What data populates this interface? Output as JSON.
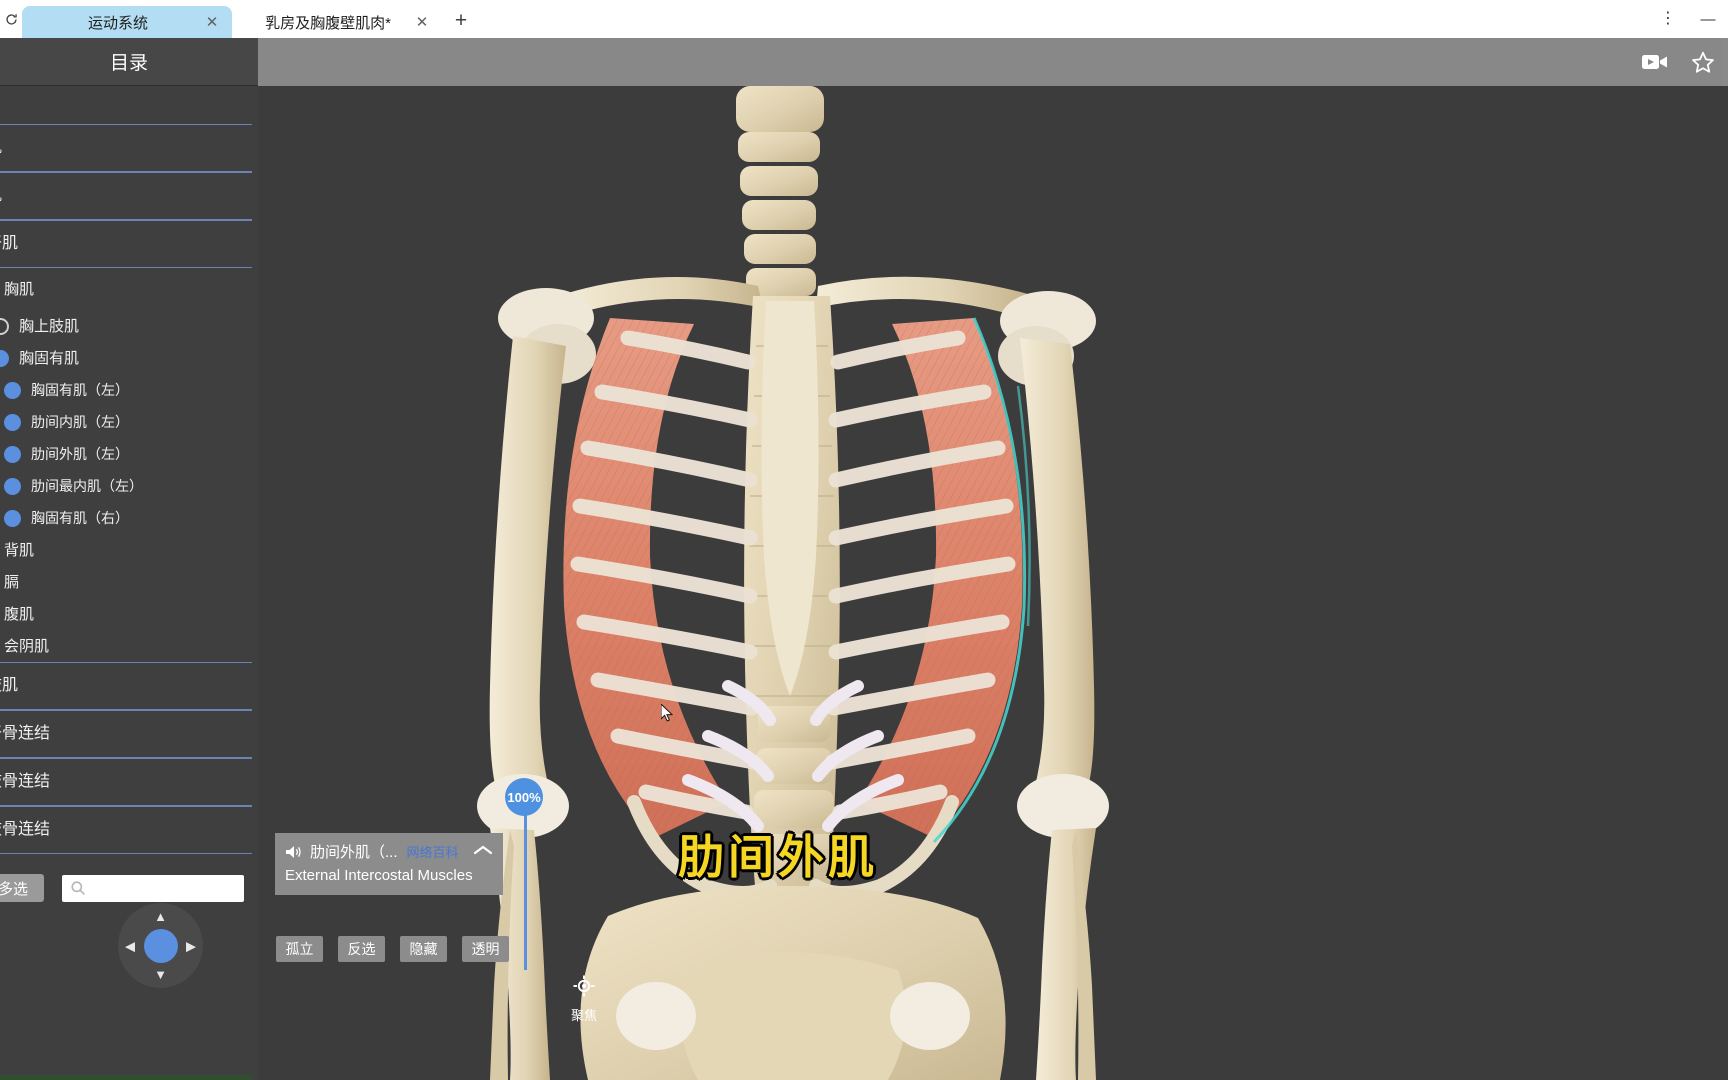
{
  "browser": {
    "tabs": [
      {
        "title": "运动系统",
        "active": true,
        "close_label": "✕"
      },
      {
        "title": "乳房及胸腹壁肌肉*",
        "active": false,
        "close_label": "✕"
      }
    ],
    "new_tab_label": "+",
    "menu_label": "⋮",
    "minimize_label": "—",
    "left_icon": "refresh-icon"
  },
  "toolbar": {
    "video_icon": "video-camera-icon",
    "star_icon": "star-outline-icon"
  },
  "sidebar": {
    "header_title": "目录",
    "tree": [
      {
        "label": "肌",
        "type": "group"
      },
      {
        "label": "肌",
        "type": "group"
      },
      {
        "label": "干肌",
        "type": "group"
      },
      {
        "label": "胸肌",
        "type": "sub"
      },
      {
        "label": "胸上肢肌",
        "type": "sub2",
        "marker": "ring"
      },
      {
        "label": "胸固有肌",
        "type": "sub2",
        "marker": "dot"
      },
      {
        "label": "胸固有肌（左）",
        "type": "leaf",
        "marker": "dot"
      },
      {
        "label": "肋间内肌（左）",
        "type": "leaf",
        "marker": "dot"
      },
      {
        "label": "肋间外肌（左）",
        "type": "leaf",
        "marker": "dot"
      },
      {
        "label": "肋间最内肌（左）",
        "type": "leaf",
        "marker": "dot"
      },
      {
        "label": "胸固有肌（右）",
        "type": "leaf",
        "marker": "dot"
      },
      {
        "label": "背肌",
        "type": "sub"
      },
      {
        "label": "膈",
        "type": "sub"
      },
      {
        "label": "腹肌",
        "type": "sub"
      },
      {
        "label": "会阴肌",
        "type": "sub"
      },
      {
        "label": "肢肌",
        "type": "group"
      },
      {
        "label": "干骨连结",
        "type": "group"
      },
      {
        "label": "肢骨连结",
        "type": "group"
      },
      {
        "label": "肢骨连结",
        "type": "group"
      }
    ],
    "multi_select_label": "多选",
    "search_placeholder": "",
    "search_value": "",
    "search_icon": "search-icon",
    "dpad": {
      "up": "▲",
      "down": "▼",
      "left": "◀",
      "right": "▶",
      "center": "dpad-center-button"
    }
  },
  "viewport": {
    "opacity": {
      "value_label": "100%",
      "slider_name": "opacity-slider"
    },
    "info_panel": {
      "speaker_icon": "speaker-icon",
      "name_cn": "肋间外肌（...",
      "link_text": "网络百科",
      "name_en": "External Intercostal Muscles",
      "collapse_icon": "chevron-up-icon"
    },
    "actions": [
      {
        "label": "孤立"
      },
      {
        "label": "反选"
      },
      {
        "label": "隐藏"
      },
      {
        "label": "透明"
      }
    ],
    "focus": {
      "icon": "crosshair-focus-icon",
      "label": "聚焦"
    },
    "model_label": "肋间外肌"
  },
  "colors": {
    "accent_blue": "#5b8fe0",
    "tab_active": "#b3ddf2",
    "sidebar_bg": "#3f3f3f",
    "toolbar_grey": "#888888",
    "label_yellow": "#f5d623",
    "muscle_red": "#e08a72",
    "bone_cream": "#e8dcc0"
  }
}
